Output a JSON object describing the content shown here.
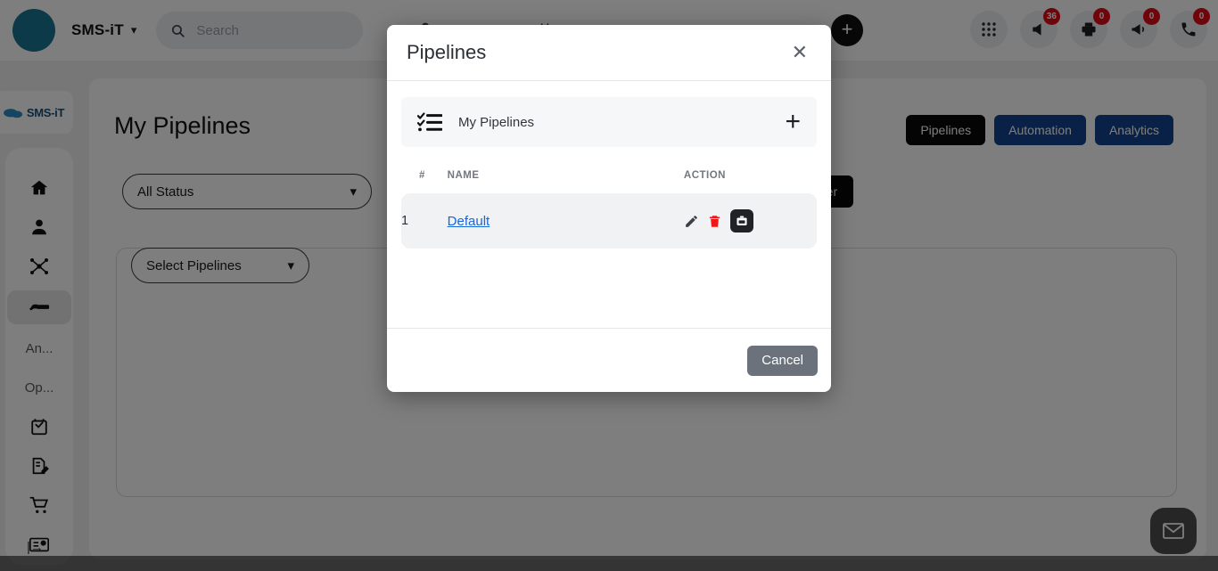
{
  "topbar": {
    "brand": "SMS-iT",
    "brand_caret_icon": "chevron-down-icon",
    "search_placeholder": "Search",
    "search_icon": "search-icon",
    "add_button_label": "+",
    "apps_icon": "grid-apps-icon",
    "notifications": [
      {
        "icon": "megaphone-icon",
        "count": "36"
      },
      {
        "icon": "printer-icon",
        "count": "0"
      },
      {
        "icon": "announcement-icon",
        "count": "0"
      },
      {
        "icon": "phone-icon",
        "count": "0"
      }
    ]
  },
  "sidebar": {
    "logo_text": "SMS-iT",
    "items": [
      {
        "icon": "home-icon",
        "label": ""
      },
      {
        "icon": "user-icon",
        "label": ""
      },
      {
        "icon": "network-nodes-icon",
        "label": ""
      },
      {
        "icon": "pipeline-icon",
        "label": "",
        "active": true
      },
      {
        "icon": "",
        "label": "An..."
      },
      {
        "icon": "",
        "label": "Op..."
      },
      {
        "icon": "calendar-check-icon",
        "label": ""
      },
      {
        "icon": "document-edit-icon",
        "label": ""
      },
      {
        "icon": "shopping-cart-icon",
        "label": ""
      },
      {
        "icon": "id-card-icon",
        "label": ""
      }
    ],
    "collapse_icon": "collapse-sidebar-icon"
  },
  "page": {
    "title": "My Pipelines",
    "buttons": [
      {
        "label": "Pipelines",
        "style": "dark"
      },
      {
        "label": "Automation",
        "style": "blue"
      },
      {
        "label": "Analytics",
        "style": "blue"
      }
    ],
    "status_select": {
      "value": "All Status",
      "caret_icon": "chevron-down-icon"
    },
    "pipeline_select": {
      "value": "Select Pipelines",
      "caret_icon": "chevron-down-icon"
    },
    "filter_button": "Filter",
    "mail_fab_icon": "envelope-icon"
  },
  "modal": {
    "title": "Pipelines",
    "close_icon": "close-icon",
    "section": {
      "icon": "checklist-icon",
      "label": "My Pipelines",
      "add_icon": "plus-icon",
      "add_label": "+"
    },
    "table": {
      "headers": {
        "num": "#",
        "name": "NAME",
        "action": "ACTION"
      },
      "rows": [
        {
          "num": "1",
          "name": "Default",
          "actions": [
            {
              "icon": "pencil-edit-icon",
              "color": "#3c4043"
            },
            {
              "icon": "trash-delete-icon",
              "color": "#f41616"
            },
            {
              "icon": "briefcase-archive-icon",
              "color": "#202326"
            }
          ]
        }
      ]
    },
    "cancel_label": "Cancel"
  },
  "colors": {
    "accent_blue": "#14448f",
    "link_blue": "#1767d6",
    "danger_red": "#f41616",
    "badge_red": "#e00b16",
    "dark": "#090909",
    "cancel_gray": "#6b727c"
  }
}
